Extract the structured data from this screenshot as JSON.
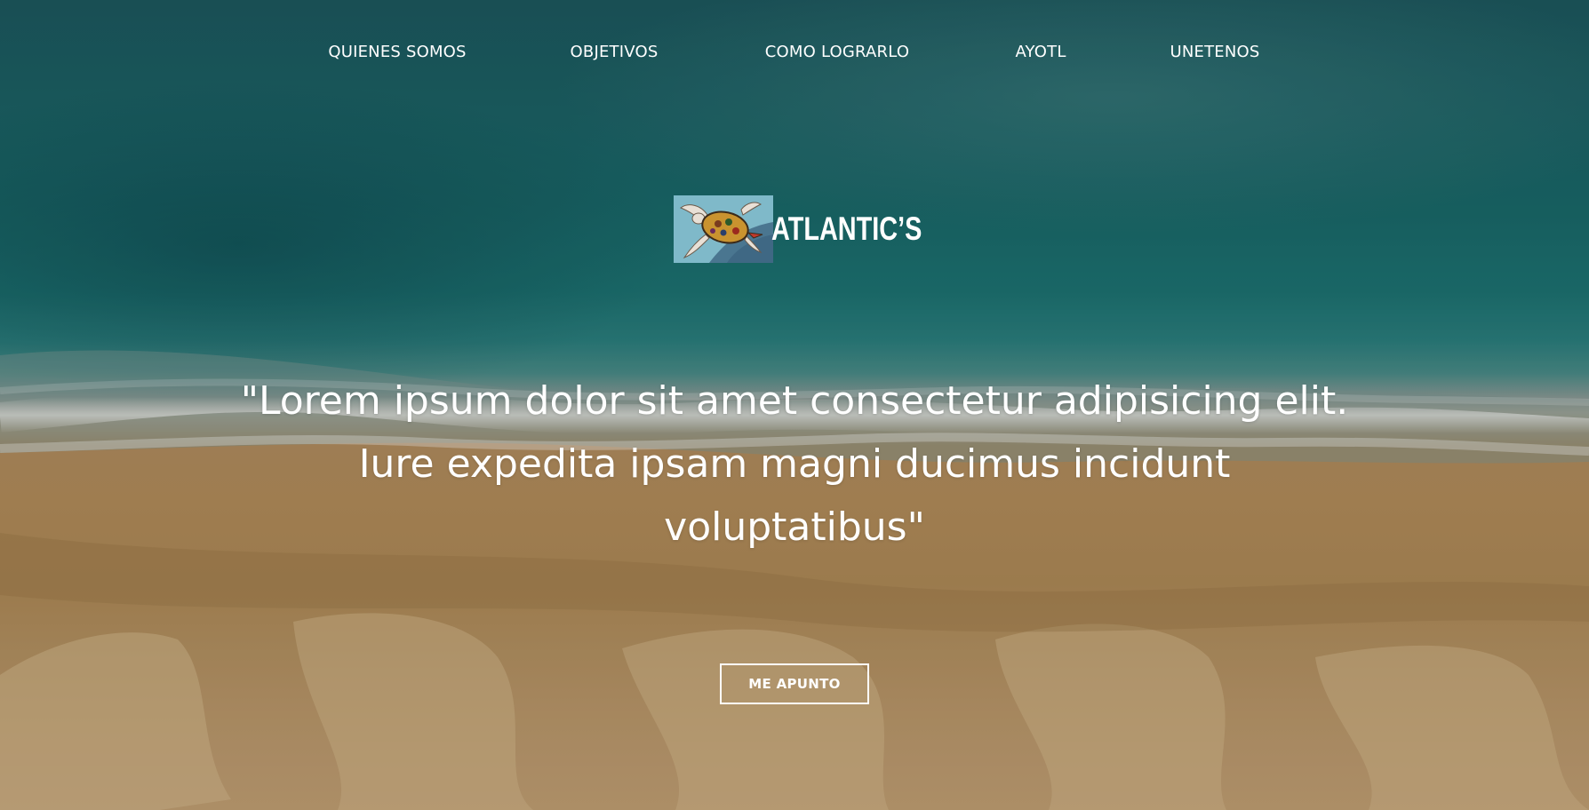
{
  "nav": {
    "items": [
      {
        "label": "QUIENES SOMOS"
      },
      {
        "label": "OBJETIVOS"
      },
      {
        "label": "COMO LOGRARLO"
      },
      {
        "label": "AYOTL"
      },
      {
        "label": "UNETENOS"
      }
    ]
  },
  "logo": {
    "text": "ATLANTIC’S",
    "icon": "sea-turtle-icon"
  },
  "hero": {
    "quote": "\"Lorem ipsum dolor sit amet consectetur adipisicing elit. Iure expedita ipsam magni ducimus incidunt voluptatibus\""
  },
  "cta": {
    "label": "ME APUNTO"
  },
  "colors": {
    "text": "#ffffff",
    "ocean": "#1d6a6b",
    "sand": "#b58f5c",
    "logo_bg": "#4a7690"
  }
}
